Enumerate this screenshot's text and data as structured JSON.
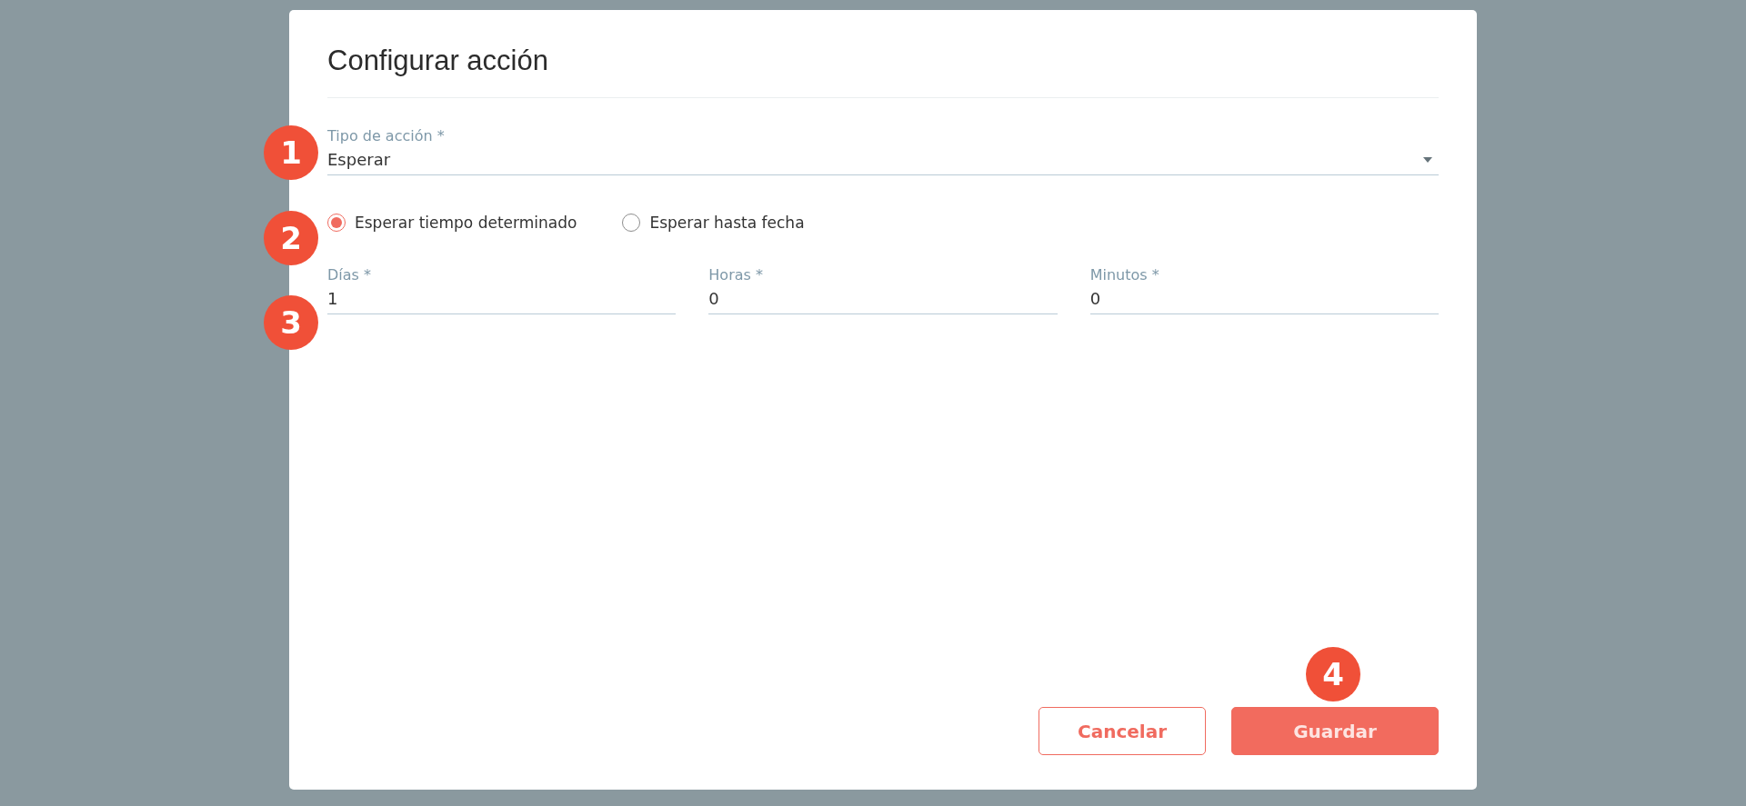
{
  "dialog": {
    "title": "Configurar acción",
    "action_type": {
      "label": "Tipo de acción *",
      "value": "Esperar"
    },
    "wait_mode": [
      {
        "label": "Esperar tiempo determinado",
        "selected": true
      },
      {
        "label": "Esperar hasta fecha",
        "selected": false
      }
    ],
    "duration_fields": [
      {
        "label": "Días *",
        "value": "1"
      },
      {
        "label": "Horas *",
        "value": "0"
      },
      {
        "label": "Minutos *",
        "value": "0"
      }
    ],
    "buttons": [
      {
        "label": "Cancelar",
        "kind": "secondary"
      },
      {
        "label": "Guardar",
        "kind": "primary"
      }
    ]
  },
  "step_markers": [
    "1",
    "2",
    "3",
    "4"
  ]
}
